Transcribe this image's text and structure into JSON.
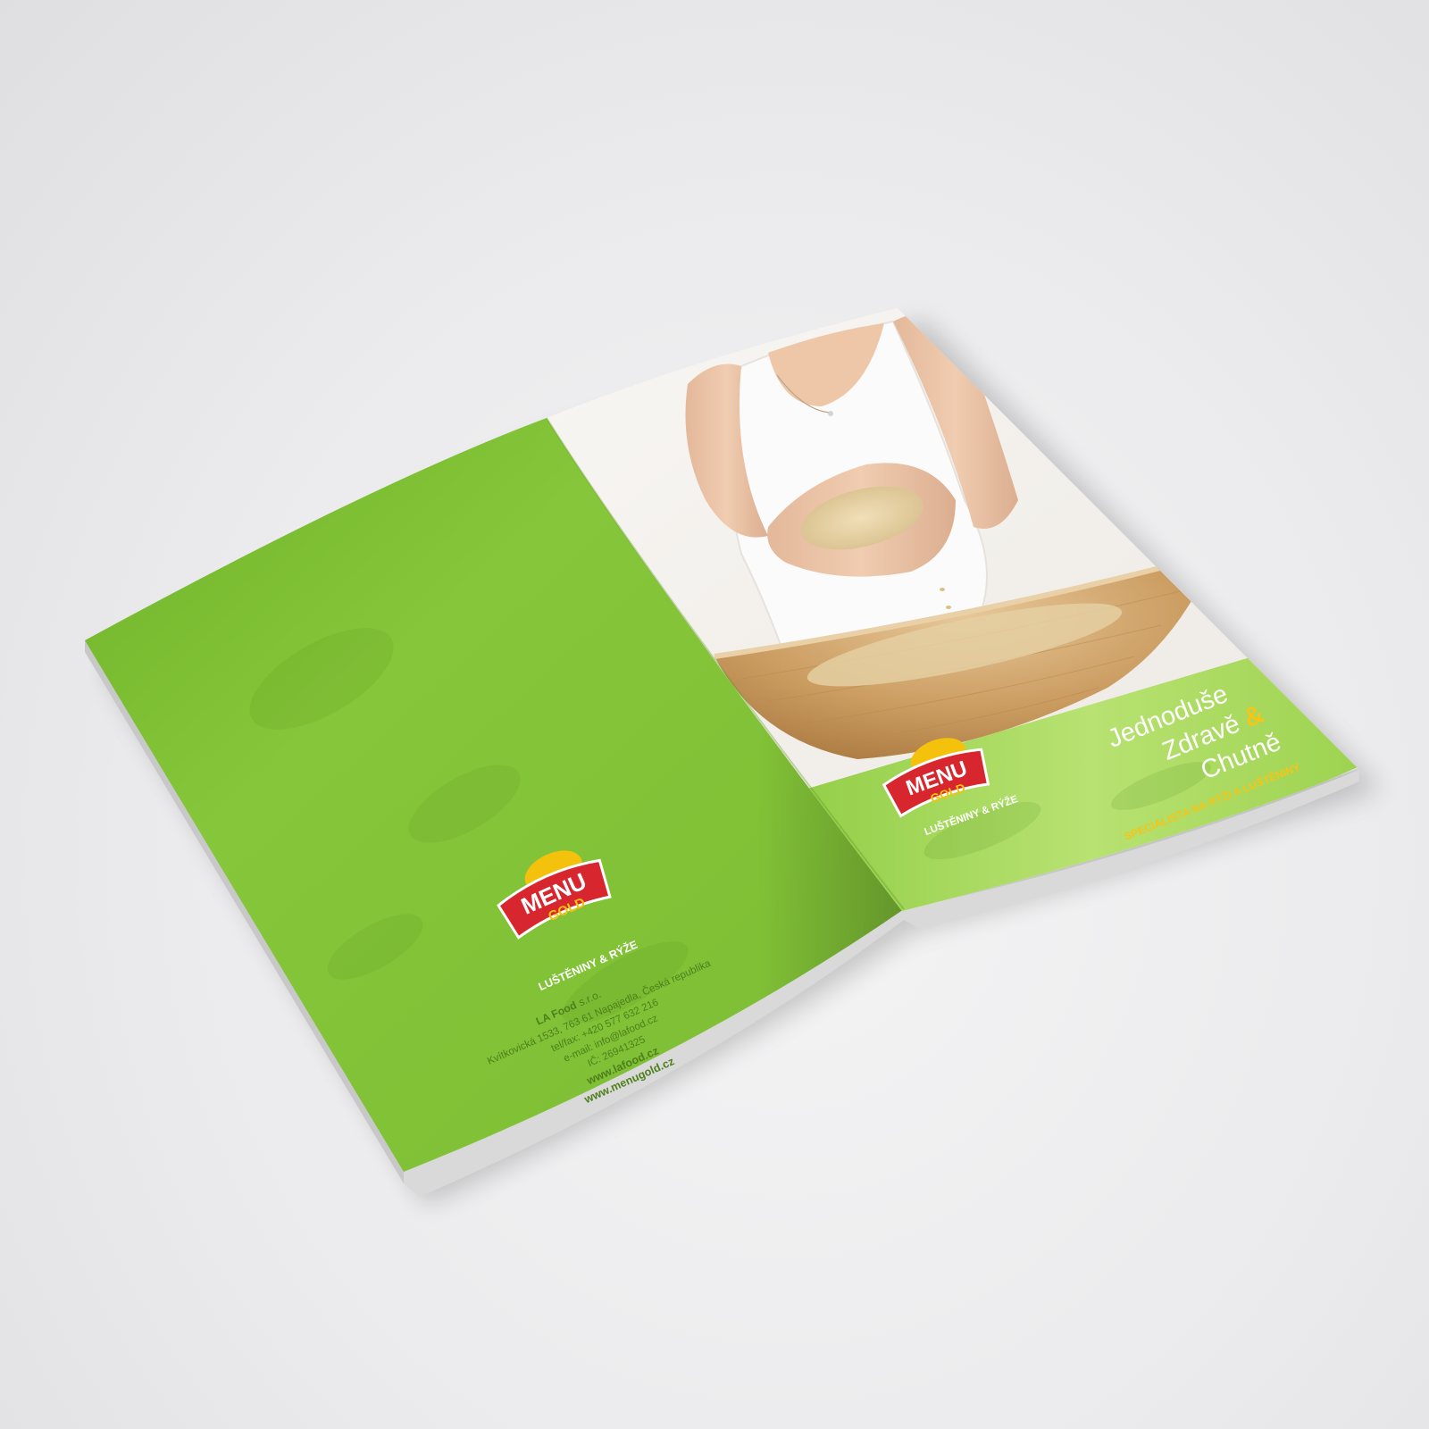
{
  "colors": {
    "background": "#ececee",
    "cover_green": "#86c63a",
    "cover_green_light": "#b4e06c",
    "cover_green_dark": "#6fae27",
    "logo_red": "#d7262e",
    "logo_gold": "#f4c20d",
    "tagline_yellow": "#f5c518",
    "title_white": "#ffffff"
  },
  "back_cover": {
    "logo": {
      "word_top": "MENU",
      "word_bottom": "GOLD"
    },
    "subtitle": "LUŠTĚNINY & RÝŽE",
    "company_name": "LA Food",
    "company_suffix": "s.r.o.",
    "address": "Kvítkovická 1533, 763 61 Napajedla, Česká republika",
    "phone": "tel/fax: +420 577 632 216",
    "email": "e-mail: info@lafood.cz",
    "ic": "IČ: 26941325",
    "web_1": "www.lafood.cz",
    "web_2": "www.menugold.cz"
  },
  "front_cover": {
    "photo_icon": "woman-pouring-rice-into-bamboo-bowl",
    "logo": {
      "word_top": "MENU",
      "word_bottom": "GOLD"
    },
    "subtitle": "LUŠTĚNINY & RÝŽE",
    "headline_line_1": "Jednoduše",
    "headline_line_2": "Zdravě",
    "headline_ampersand": "&",
    "headline_line_3": "Chutně",
    "tagline": "SPECIALISTA NA RÝŽI A LUŠTĚNINY"
  }
}
